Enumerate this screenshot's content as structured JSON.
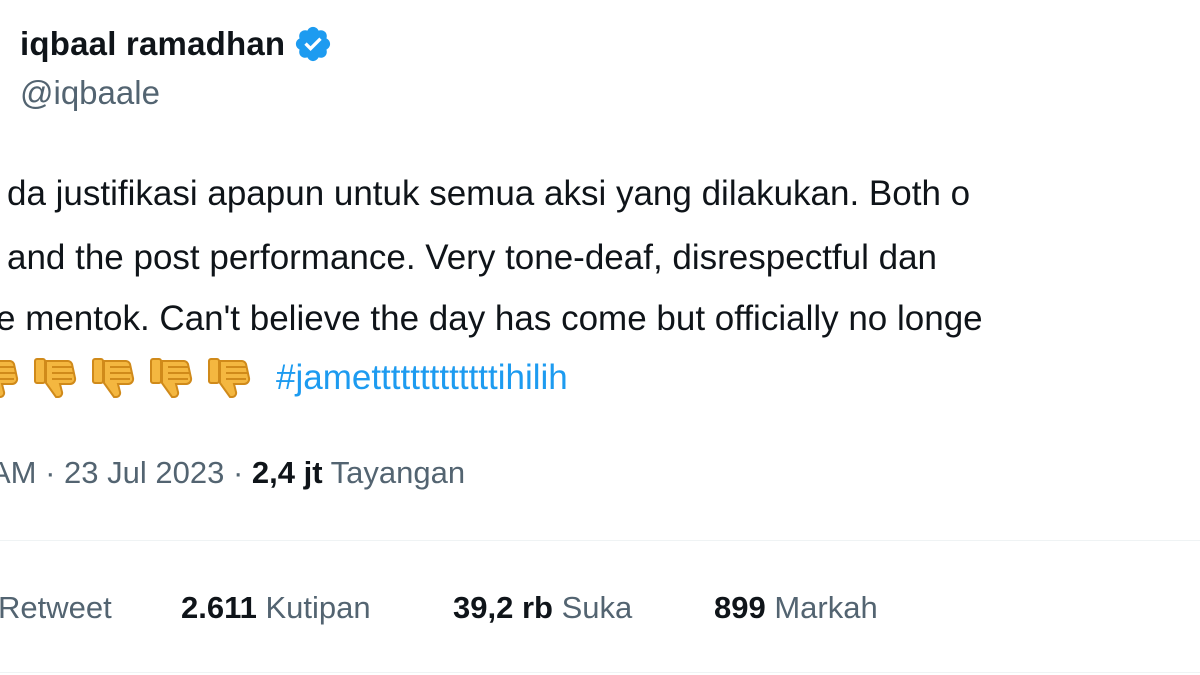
{
  "author": {
    "display_name": "iqbaal ramadhan",
    "handle": "@iqbaale",
    "verified_icon": "verified-badge-icon",
    "badge_color": "#1d9bf0"
  },
  "tweet": {
    "line1": "da justifikasi apapun untuk semua aksi yang dilakukan. Both o",
    "line2": "and the post performance. Very tone-deaf, disrespectful dan",
    "line3": "e mentok. Can't believe the day has come but officially no longe",
    "emoji": "thumbs-down-icon",
    "emoji_count": 5,
    "hashtag": "#jametttttttttttttihilih",
    "hashtag_color": "#1d9bf0"
  },
  "meta": {
    "time_prefix": "AM · 23 Jul 2023 ·",
    "views_count": "2,4 jt",
    "views_label": "Tayangan"
  },
  "stats": {
    "retweet_label": "Retweet",
    "quotes_count": "2.611",
    "quotes_label": "Kutipan",
    "likes_count": "39,2 rb",
    "likes_label": "Suka",
    "bookmarks_count": "899",
    "bookmarks_label": "Markah"
  }
}
